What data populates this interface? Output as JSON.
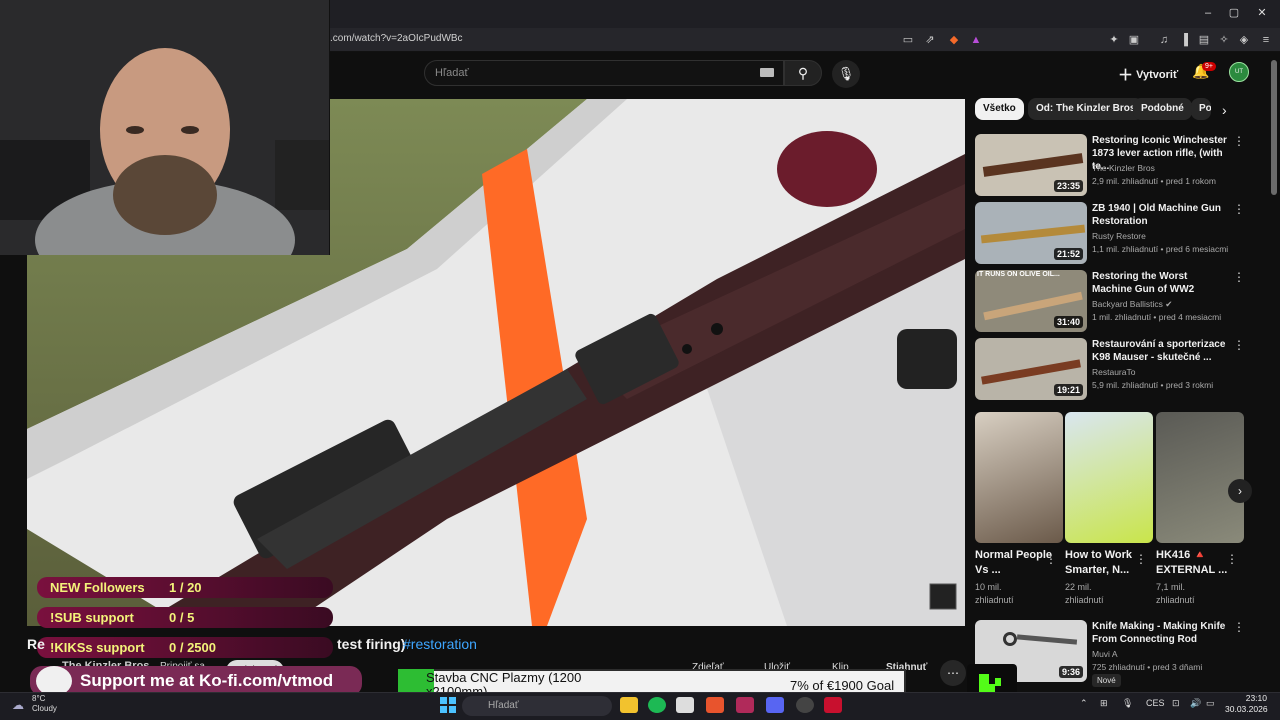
{
  "browser": {
    "url": ".com/watch?v=2aOIcPudWBc",
    "window_controls": [
      "–",
      "▢",
      "✕"
    ]
  },
  "header": {
    "search_placeholder": "Hľadať",
    "create_label": "Vytvoriť",
    "notifications_badge": "9+",
    "avatar_text": "UT"
  },
  "video": {
    "title_prefix": "Re",
    "title_suffix": "test firing)",
    "title_tag": "#restoration",
    "channel": "The Kinzler Bros",
    "join_label": "Pripojiť sa",
    "subscribe_label": "Odoberať",
    "actions": [
      "Zdieľať",
      "Uložiť",
      "Klip",
      "Stiahnuť"
    ]
  },
  "stream_overlay": {
    "rows": [
      {
        "label": "NEW Followers",
        "value": "1 / 20"
      },
      {
        "label": "!SUB support",
        "value": "0 / 5"
      },
      {
        "label": "!KIKSs support",
        "value": "0 / 2500"
      }
    ],
    "kofi_text": "Support me at Ko-fi.com/vtmod",
    "goal_title": "Stavba CNC Plazmy (1200 x2100mm)",
    "goal_value": "7% of €1900 Goal",
    "goal_progress": 0.07
  },
  "chips": [
    "Všetko",
    "Od: The Kinzler Bros",
    "Podobné",
    "Po"
  ],
  "sidebar": {
    "videos": [
      {
        "title": "Restoring Iconic Winchester 1873 lever action rifle, (with te...",
        "channel": "The Kinzler Bros",
        "meta": "2,9 mil. zhliadnutí • pred 1 rokom",
        "duration": "23:35"
      },
      {
        "title": "ZB 1940 | Old Machine Gun Restoration",
        "channel": "Rusty Restore",
        "meta": "1,1 mil. zhliadnutí • pred 6 mesiacmi",
        "duration": "21:52"
      },
      {
        "title": "Restoring the Worst Machine Gun of WW2",
        "channel": "Backyard Ballistics",
        "meta": "1 mil. zhliadnutí • pred 4 mesiacmi",
        "duration": "31:40",
        "thumb_text": "IT RUNS ON OLIVE OIL..."
      },
      {
        "title": "Restaurování a sporterizace K98 Mauser - skutečné ...",
        "channel": "RestauraTo",
        "meta": "5,9 mil. zhliadnutí • pred 3 rokmi",
        "duration": "19:21"
      }
    ],
    "shorts": [
      {
        "title": "Normal People Vs ...",
        "views": "10 mil.",
        "unit": "zhliadnutí"
      },
      {
        "title": "How to Work Smarter, N...",
        "views": "22 mil.",
        "unit": "zhliadnutí"
      },
      {
        "title": "HK416 🔺 EXTERNAL ...",
        "views": "7,1 mil.",
        "unit": "zhliadnutí"
      }
    ],
    "last_video": {
      "title": "Knife Making - Making Knife From Connecting Rod",
      "channel": "Muvi A",
      "meta": "725 zhliadnutí • pred 3 dňami",
      "duration": "9:36",
      "badge": "Nové"
    }
  },
  "taskbar": {
    "weather_temp": "8°C",
    "weather_desc": "Cloudy",
    "search": "Hľadať",
    "lang": "CES",
    "time": "23:10",
    "date": "30.03.2026"
  }
}
